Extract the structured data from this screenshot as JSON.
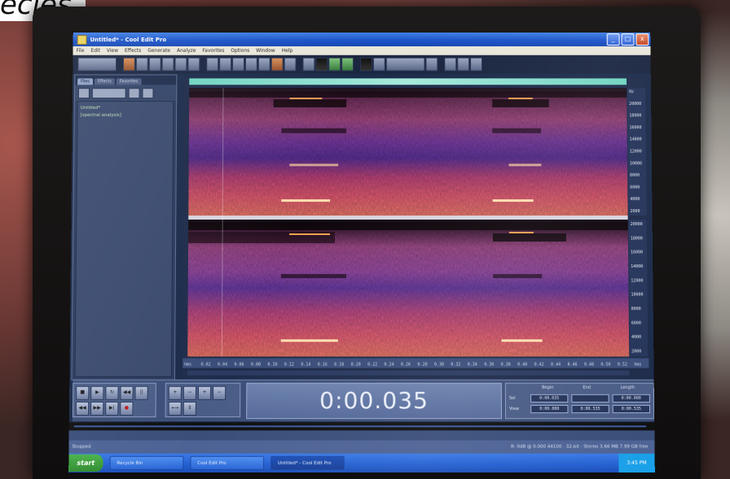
{
  "caption": "ecies.",
  "window": {
    "title": "Untitled* - Cool Edit Pro",
    "minimize": "_",
    "maximize": "□",
    "close": "x"
  },
  "menu": [
    "File",
    "Edit",
    "View",
    "Effects",
    "Generate",
    "Analyze",
    "Favorites",
    "Options",
    "Window",
    "Help"
  ],
  "file_panel": {
    "tabs": [
      "Files",
      "Effects",
      "Favorites"
    ],
    "files": [
      "Untitled*",
      "[spectral analysis]"
    ]
  },
  "spectral": {
    "freq_ticks_top": [
      "Hz",
      "20000",
      "18000",
      "16000",
      "14000",
      "12000",
      "10000",
      "8000",
      "6000",
      "4000",
      "2000"
    ],
    "freq_ticks_bottom": [
      "20000",
      "18000",
      "16000",
      "14000",
      "12000",
      "10000",
      "8000",
      "6000",
      "4000",
      "2000"
    ],
    "time_ticks": [
      "hms",
      "0.02",
      "0.04",
      "0.06",
      "0.08",
      "0.10",
      "0.12",
      "0.14",
      "0.16",
      "0.18",
      "0.20",
      "0.22",
      "0.24",
      "0.26",
      "0.28",
      "0.30",
      "0.32",
      "0.34",
      "0.36",
      "0.38",
      "0.40",
      "0.42",
      "0.44",
      "0.46",
      "0.48",
      "0.50",
      "0.52",
      "hms"
    ]
  },
  "transport": {
    "buttons": [
      "■",
      "▶",
      "↻",
      "◀◀",
      "||",
      "◀◀",
      "▶▶",
      "▶|",
      "●"
    ],
    "zoom_buttons": [
      "+",
      "−",
      "+",
      "−",
      "⟷",
      "⇕"
    ]
  },
  "time_display": "0:00.035",
  "selection": {
    "headers": [
      "Begin",
      "End",
      "Length"
    ],
    "rows": [
      {
        "label": "Sel",
        "begin": "0:00.035",
        "end": "",
        "length": "0:00.000"
      },
      {
        "label": "View",
        "begin": "0:00.000",
        "end": "0:00.535",
        "length": "0:00.535"
      }
    ]
  },
  "status": {
    "left": "Stopped",
    "right": "R: 0dB @ 0.000   44100 · 32-bit · Stereo   3.66 MB   7.99 GB free"
  },
  "taskbar": {
    "start": "start",
    "tasks": [
      "Recycle Bin",
      "Cool Edit Pro",
      "Untitled* - Cool Edit Pro"
    ],
    "tray": "3:45 PM"
  }
}
